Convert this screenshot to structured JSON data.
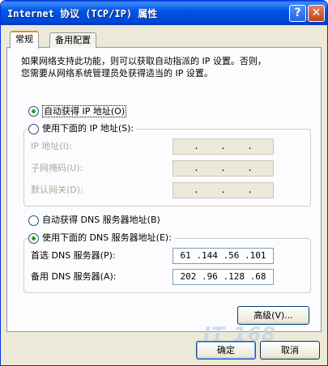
{
  "window": {
    "title": "Internet 协议 (TCP/IP) 属性",
    "help_label": "?",
    "close_label": "✕"
  },
  "tabs": [
    {
      "label": "常规",
      "active": true
    },
    {
      "label": "备用配置",
      "active": false
    }
  ],
  "description_lines": [
    "如果网络支持此功能，则可以获取自动指派的 IP 设置。否则，",
    "您需要从网络系统管理员处获得适当的 IP 设置。"
  ],
  "ip_section": {
    "auto_option": "自动获得 IP 地址(O)",
    "manual_option": "使用下面的 IP 地址(S):",
    "selected": "auto",
    "fields": [
      {
        "label": "IP 地址(I):",
        "value": ".    .    ."
      },
      {
        "label": "子网掩码(U):",
        "value": ".    .    ."
      },
      {
        "label": "默认网关(D):",
        "value": ".    .    ."
      }
    ]
  },
  "dns_section": {
    "auto_option": "自动获得 DNS 服务器地址(B)",
    "manual_option": "使用下面的 DNS 服务器地址(E):",
    "selected": "manual",
    "fields": [
      {
        "label": "首选 DNS 服务器(P):",
        "value": "61 .144 .56 .101"
      },
      {
        "label": "备用 DNS 服务器(A):",
        "value": "202 .96 .128 .68"
      }
    ]
  },
  "buttons": {
    "advanced": "高级(V)...",
    "ok": "确定",
    "cancel": "取消"
  },
  "watermark": "IT 168"
}
